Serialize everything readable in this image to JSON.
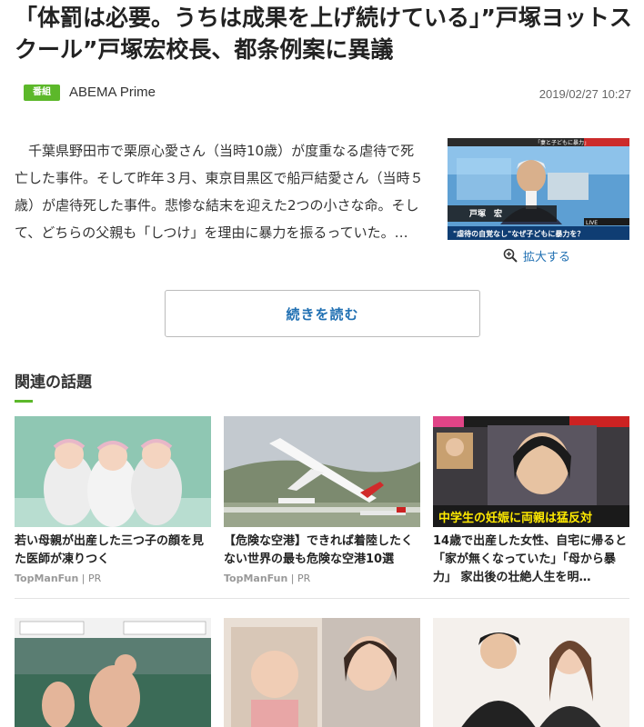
{
  "article": {
    "headline": "「体罰は必要。うちは成果を上げ続けている」”戸塚ヨットスクール”戸塚宏校長、都条例案に異議",
    "badge": "番組",
    "source": "ABEMA Prime",
    "timestamp": "2019/02/27 10:27",
    "summary": "千葉県野田市で栗原心愛さん（当時10歳）が度重なる虐待で死亡した事件。そして昨年３月、東京目黒区で船戸結愛さん（当時５歳）が虐待死した事件。悲惨な結末を迎えた2つの小さな命。そして、どちらの父親も「しつけ」を理由に暴力を振るっていた。…",
    "enlarge_label": "拡大する",
    "read_more_label": "続きを読む",
    "thumb": {
      "top_caption": "「妻と子どもに暴力」",
      "name": "戸塚　宏",
      "bottom_caption": "\"虐待の自覚なし\"なぜ子どもに暴力を？",
      "live": "LIVE"
    }
  },
  "related": {
    "title": "関連の話題",
    "cards": [
      {
        "caption": "若い母親が出産した三つ子の顔を見た医師が凍りつく",
        "sponsor_name": "TopManFun",
        "sponsor_tag": "PR"
      },
      {
        "caption": "【危険な空港】できれば着陸したくない世界の最も危険な空港10選",
        "sponsor_name": "TopManFun",
        "sponsor_tag": "PR"
      },
      {
        "caption": "14歳で出産した女性、自宅に帰ると「家が無くなっていた」「母から暴力」 家出後の壮絶人生を明…",
        "sponsor_name": "",
        "sponsor_tag": "",
        "overlay": "中学生の妊娠に両親は猛反対"
      }
    ]
  },
  "colors": {
    "accent_green": "#5cb82a",
    "link_blue": "#1f6fb2"
  }
}
